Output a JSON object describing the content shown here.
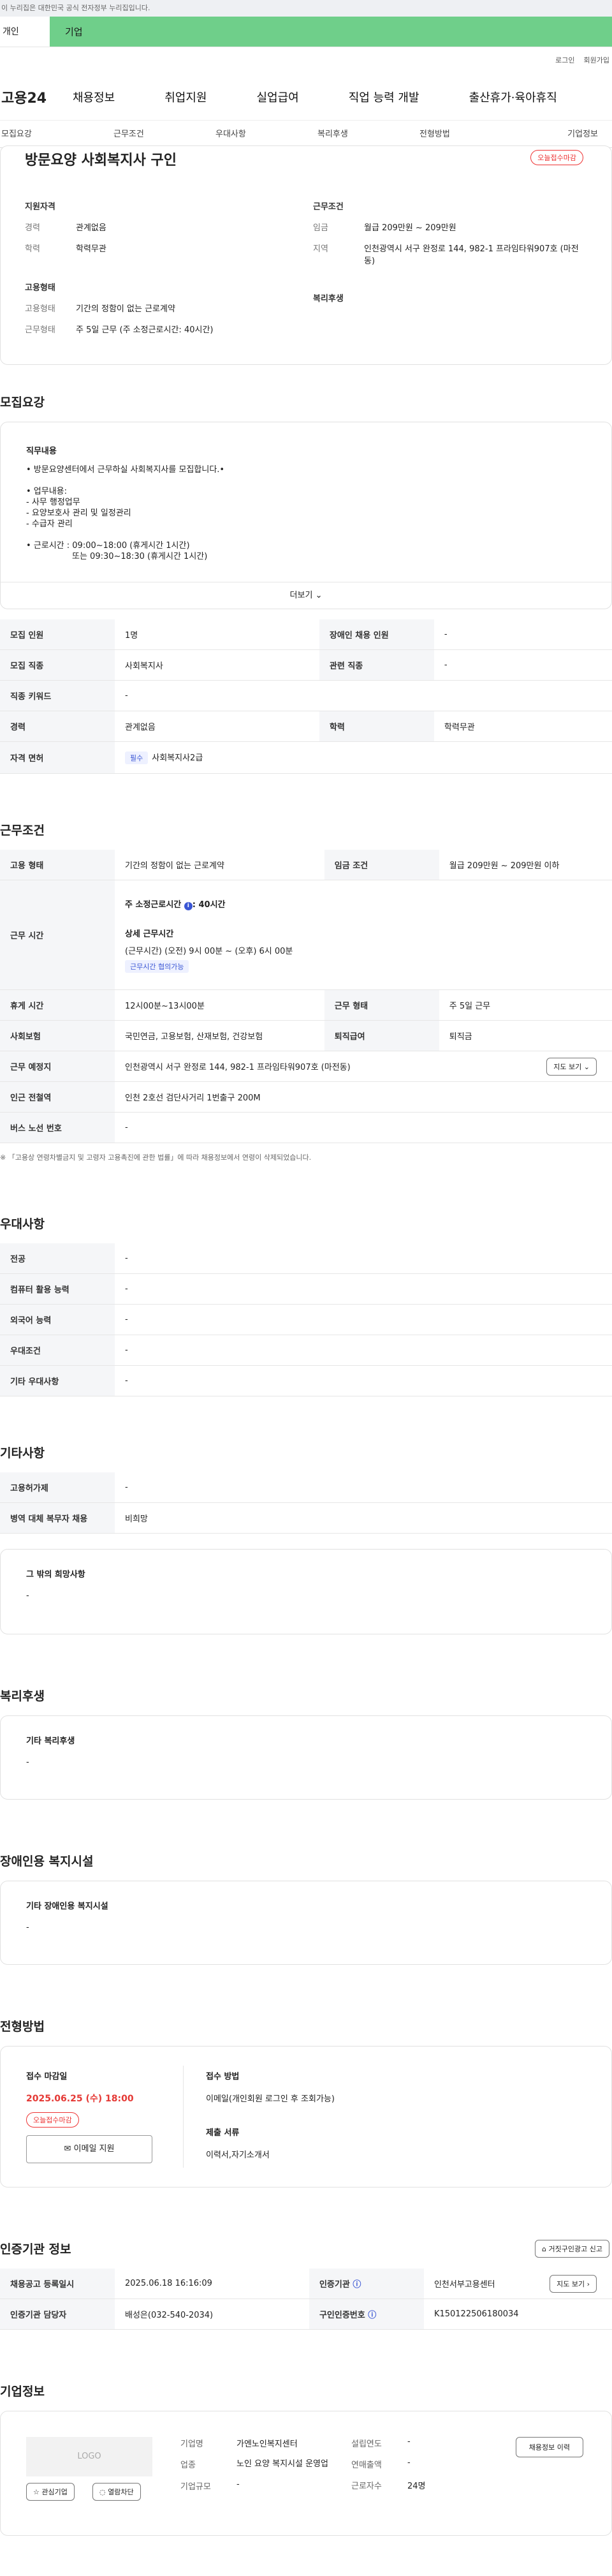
{
  "gov_banner": "이 누리집은 대한민국 공식 전자정부 누리집입니다.",
  "top_tabs": {
    "personal": "개인",
    "company": "기업"
  },
  "util": {
    "login": "로그인",
    "signup": "회원가입"
  },
  "gnb": {
    "logo": "고용24",
    "items": [
      "채용정보",
      "취업지원",
      "실업급여",
      "직업 능력 개발",
      "출산휴가·육아휴직"
    ]
  },
  "subnav": [
    "모집요강",
    "근무조건",
    "우대사항",
    "복리후생",
    "전형방법",
    "기업정보"
  ],
  "job": {
    "title": "방문요양 사회복지사 구인",
    "status": "오늘접수마감",
    "qual_h": "지원자격",
    "career_k": "경력",
    "career_v": "관계없음",
    "edu_k": "학력",
    "edu_v": "학력무관",
    "cond_h": "근무조건",
    "wage_k": "임금",
    "wage_v": "월급 209만원 ~ 209만원",
    "loc_k": "지역",
    "loc_v": "인천광역시 서구 완정로 144, 982-1 프라임타워907호 (마전동)",
    "emp_h": "고용형태",
    "emp_k": "고용형태",
    "emp_v": "기간의 정함이 없는 근로계약",
    "work_k": "근무형태",
    "work_v": "주 5일 근무 (주 소정근로시간: 40시간)",
    "welfare_h": "복리후생"
  },
  "recruit": {
    "title": "모집요강",
    "duty_h": "직무내용",
    "duty_lines": [
      "• 방문요양센터에서 근무하실 사회복지사를 모집합니다.•",
      "",
      "• 업무내용:",
      "- 사무 행정업무",
      "- 요양보호사 관리 및 일정관리",
      "- 수급자 관리",
      "",
      "• 근로시간 : 09:00~18:00 (휴게시간 1시간)",
      "또는 09:30~18:30 (휴게시간 1시간)"
    ],
    "more": "더보기",
    "rows": [
      [
        "모집 인원",
        "1명",
        "장애인 채용 인원",
        "-"
      ],
      [
        "모집 직종",
        "사회복지사",
        "관련 직종",
        "-"
      ],
      [
        "직종 키워드",
        "-",
        "",
        ""
      ],
      [
        "경력",
        "관계없음",
        "학력",
        "학력무관"
      ]
    ],
    "license_k": "자격 면허",
    "license_chip": "필수",
    "license_v": "사회복지사2급"
  },
  "cond": {
    "title": "근무조건",
    "type_k": "고용 형태",
    "type_v": "기간의 정함이 없는 근로계약",
    "pay_k": "임금 조건",
    "pay_v": "월급 209만원 ~ 209만원 이하",
    "time_k": "근무 시간",
    "weekly_label": "주 소정근로시간",
    "weekly_v": ": 40시간",
    "detail_h": "상세 근무시간",
    "detail_v": "(근무시간) (오전) 9시 00분 ~ (오후) 6시 00분",
    "detail_chip": "근무시간 협의가능",
    "rest_k": "휴게 시간",
    "rest_v": "12시00분~13시00분",
    "form_k": "근무 형태",
    "form_v": "주 5일 근무",
    "ins_k": "사회보험",
    "ins_v": "국민연금, 고용보험, 산재보험, 건강보험",
    "ret_k": "퇴직급여",
    "ret_v": "퇴직금",
    "place_k": "근무 예정지",
    "place_v": "인천광역시 서구 완정로 144, 982-1 프라임타워907호 (마전동)",
    "map": "지도 보기",
    "subway_k": "인근 전철역",
    "subway_v": "인천 2호선 검단사거리 1번출구 200M",
    "bus_k": "버스 노선 번호",
    "bus_v": "-",
    "note": "※ 「고용상 연령차별금지 및 고령자 고용촉진에 관한 법률」에 따라 채용정보에서 연령이 삭제되었습니다."
  },
  "pref": {
    "title": "우대사항",
    "rows": [
      [
        "전공",
        "-"
      ],
      [
        "컴퓨터 활용 능력",
        "-"
      ],
      [
        "외국어 능력",
        "-"
      ],
      [
        "우대조건",
        "-"
      ],
      [
        "기타 우대사항",
        "-"
      ]
    ]
  },
  "etc": {
    "title": "기타사항",
    "rows": [
      [
        "고용허가제",
        "-"
      ],
      [
        "병역 대체 복무자 채용",
        "비희망"
      ]
    ],
    "wish_h": "그 밖의 희망사항",
    "wish_v": "-"
  },
  "welfare": {
    "title": "복리후생",
    "h": "기타 복리후생",
    "v": "-"
  },
  "disab": {
    "title": "장애인용 복지시설",
    "h": "기타 장애인용 복지시설",
    "v": "-"
  },
  "sel": {
    "title": "전형방법",
    "deadline_h": "접수 마감일",
    "deadline_v": "2025.06.25 (수) 18:00",
    "deadline_badge": "오늘접수마감",
    "email_btn": "이메일 지원",
    "method_h": "접수 방법",
    "method_v": "이메일(개인회원 로그인 후 조회가능)",
    "docs_h": "제출 서류",
    "docs_v": "이력서,자기소개서"
  },
  "cert": {
    "title": "인증기관 정보",
    "report": "거짓구인광고 신고",
    "reg_k": "채용공고 등록일시",
    "reg_v": "2025.06.18 16:16:09",
    "org_k": "인증기관",
    "org_v": "인천서부고용센터",
    "map": "지도 보기",
    "mgr_k": "인증기관 담당자",
    "mgr_v": "배성은(032-540-2034)",
    "no_k": "구인인증번호",
    "no_v": "K150122506180034"
  },
  "company": {
    "title": "기업정보",
    "logo": "LOGO",
    "fav": "관심기업",
    "block": "열람차단",
    "name_k": "기업명",
    "name_v": "가엔노인복지센터",
    "ind_k": "업종",
    "ind_v": "노인 요양 복지시설 운영업",
    "size_k": "기업규모",
    "size_v": "-",
    "year_k": "설립연도",
    "year_v": "-",
    "sales_k": "연매출액",
    "sales_v": "-",
    "emp_k": "근로자수",
    "emp_v": "24명",
    "more": "채용정보 이력"
  },
  "colors": {
    "accent_green": "#6fcf8a",
    "alert_red": "#e53935",
    "link_blue": "#3a56d4"
  }
}
